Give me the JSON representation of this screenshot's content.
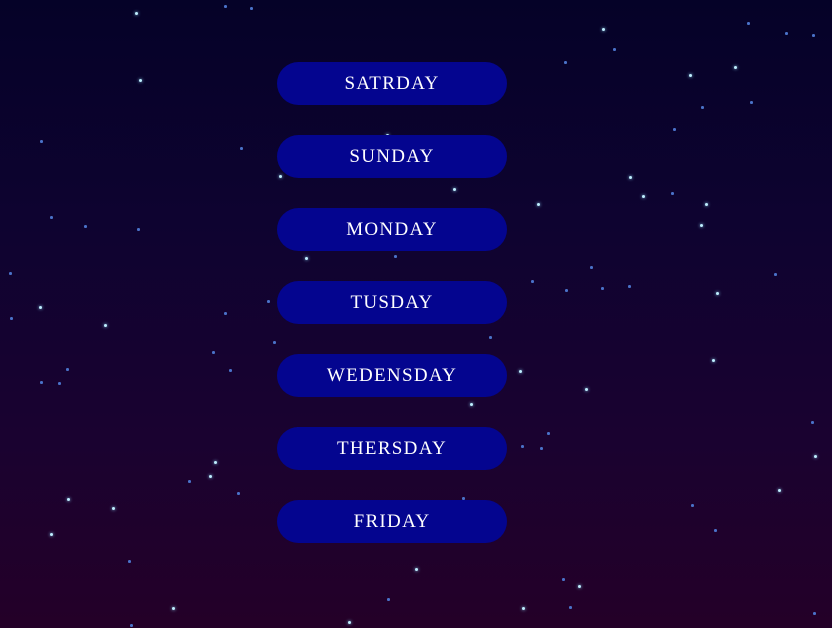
{
  "days": [
    {
      "label": "SATRDAY"
    },
    {
      "label": "SUNDAY"
    },
    {
      "label": "MONDAY"
    },
    {
      "label": "TUSDAY"
    },
    {
      "label": "WEDENSDAY"
    },
    {
      "label": "THERSDAY"
    },
    {
      "label": "FRIDAY"
    }
  ],
  "colors": {
    "button_bg": "#04058f",
    "button_text": "#ffffff",
    "sky_top": "#050228",
    "sky_bottom": "#240028"
  }
}
